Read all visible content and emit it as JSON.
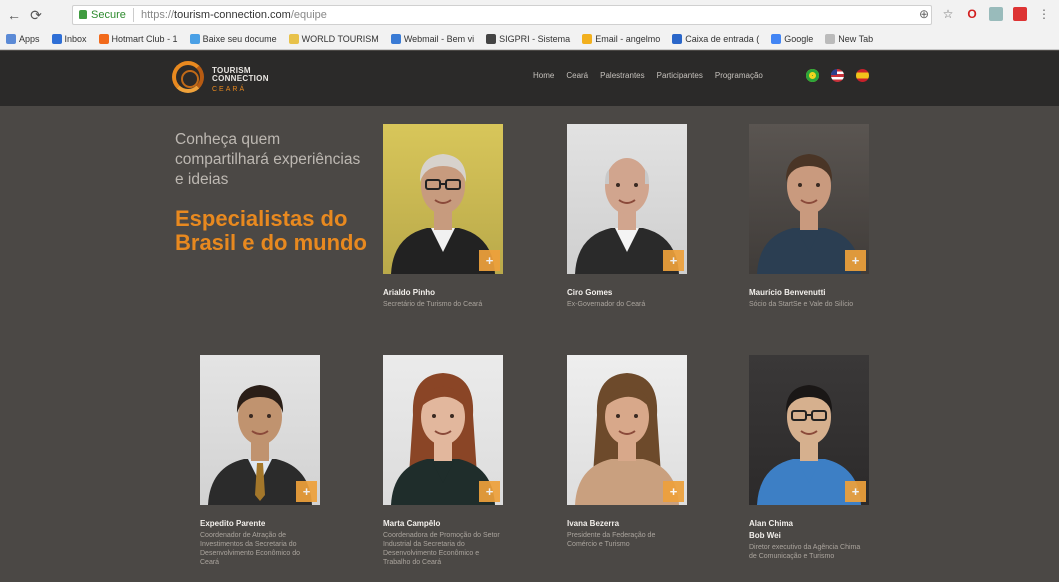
{
  "browser": {
    "secure_label": "Secure",
    "url_scheme": "https://",
    "url_host": "tourism-connection.com",
    "url_path": "/equipe",
    "bookmarks": [
      {
        "label": "Apps",
        "color": "#5b8ad6"
      },
      {
        "label": "Inbox",
        "color": "#2f6fd6"
      },
      {
        "label": "Hotmart Club - 1",
        "color": "#f26a1b"
      },
      {
        "label": "Baixe seu docume",
        "color": "#4aa0e6"
      },
      {
        "label": "WORLD TOURISM",
        "color": "#e8c24a"
      },
      {
        "label": "Webmail - Bem vi",
        "color": "#3a7bd5"
      },
      {
        "label": "SIGPRI - Sistema",
        "color": "#444444"
      },
      {
        "label": "Email - angelmo",
        "color": "#f2b01e"
      },
      {
        "label": "Caixa de entrada (",
        "color": "#2a66c9"
      },
      {
        "label": "Google",
        "color": "#4285f4"
      },
      {
        "label": "New Tab",
        "color": "#bbbbbb"
      }
    ]
  },
  "site": {
    "logo_line1": "TOURISM",
    "logo_line2": "CONNECTION",
    "logo_sub": "CEARÁ",
    "menu": [
      "Home",
      "Ceará",
      "Palestrantes",
      "Participantes",
      "Programação"
    ],
    "accent_color": "#e8891f"
  },
  "hero": {
    "intro": "Conheça quem compartilhará experiências e ideias",
    "headline": "Especialistas do Brasil e do mundo"
  },
  "speakers": [
    {
      "name": "Arialdo Pinho",
      "role": "Secretário de Turismo do Ceará"
    },
    {
      "name": "Ciro Gomes",
      "role": "Ex-Governador do Ceará"
    },
    {
      "name": "Maurício Benvenutti",
      "role": "Sócio da StartSe e Vale do Silício"
    },
    {
      "name": "Expedito Parente",
      "role": "Coordenador de Atração de Investimentos da Secretaria do Desenvolvimento Econômico do Ceará"
    },
    {
      "name": "Marta Campêlo",
      "role": "Coordenadora de Promoção do Setor Industrial da Secretaria do Desenvolvimento Econômico e Trabalho do Ceará"
    },
    {
      "name": "Ivana Bezerra",
      "role": "Presidente da Federação de Comércio e Turismo"
    },
    {
      "name": "Alan Chima",
      "role": "Diretor executivo da Agência Chima de Comunicação e Turismo",
      "subtitle": "Bob Wei"
    }
  ]
}
